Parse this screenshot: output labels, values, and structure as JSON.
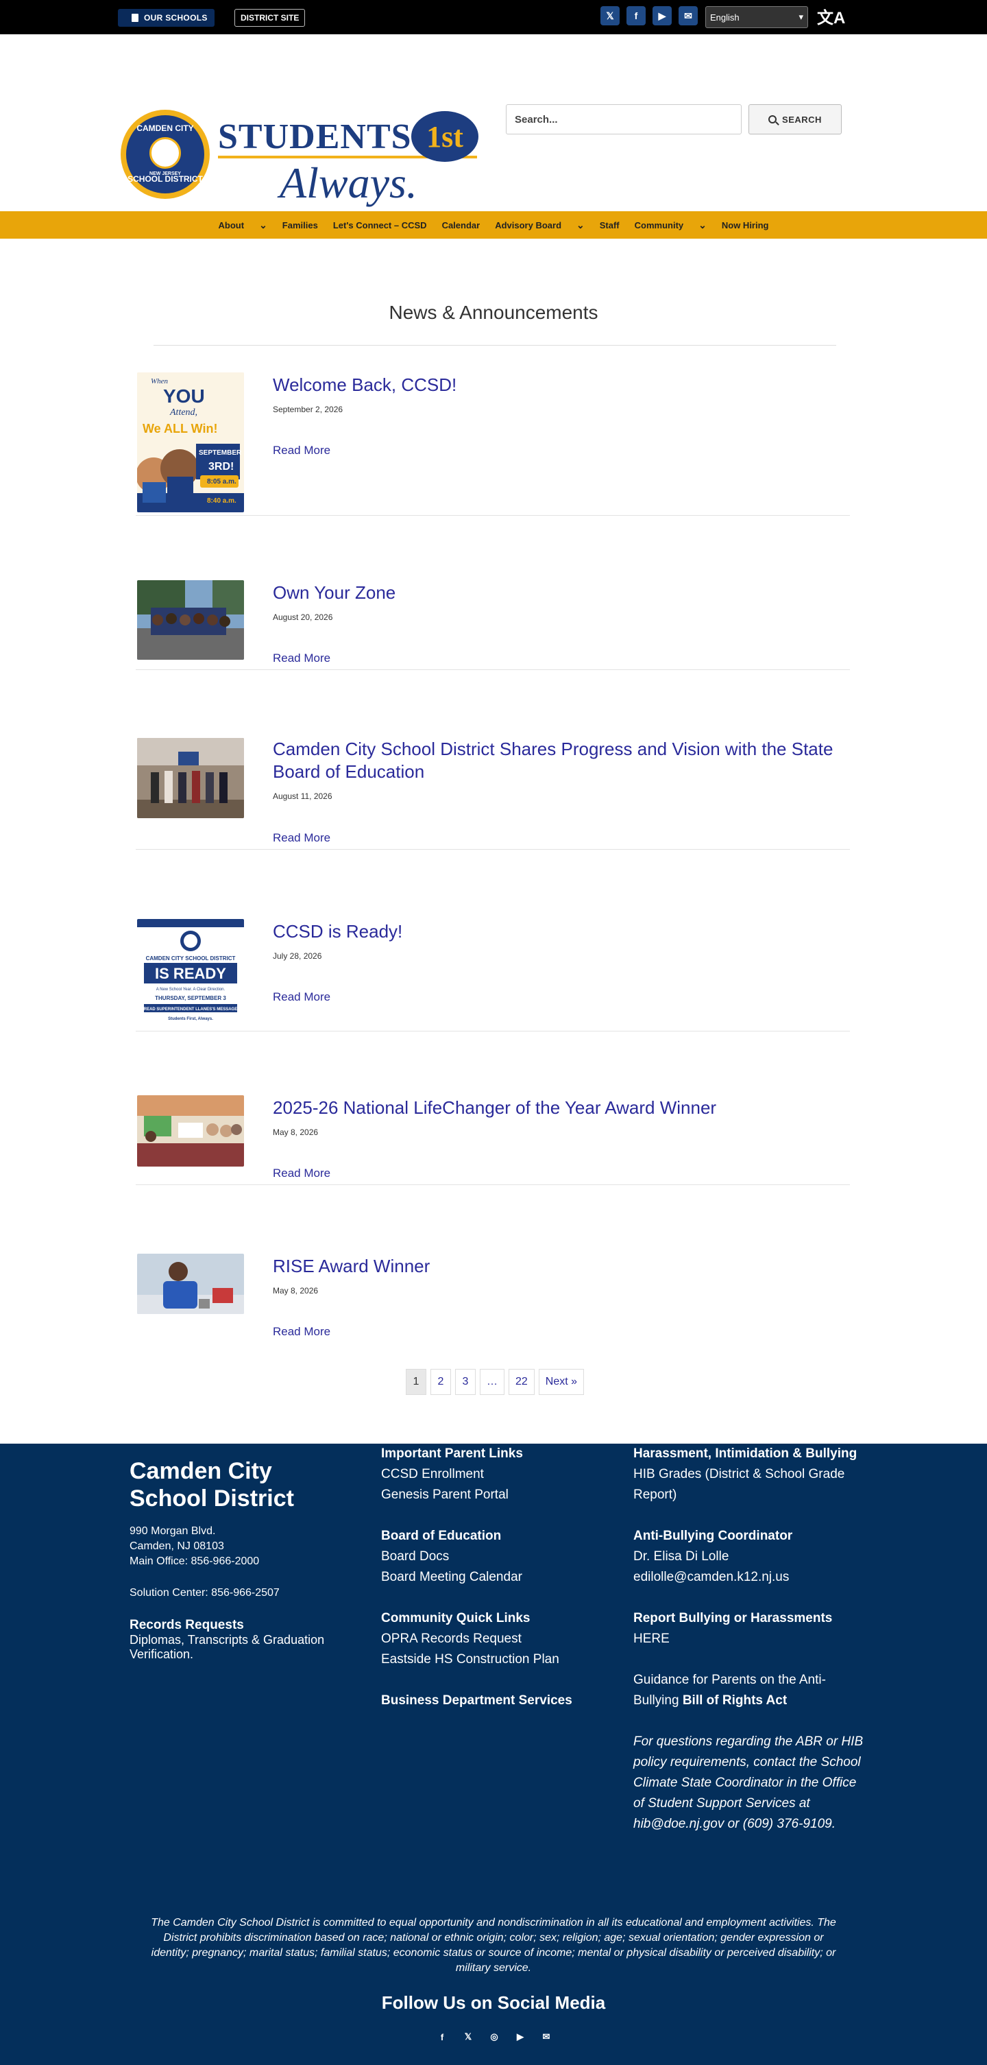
{
  "topbar": {
    "our_schools": "OUR SCHOOLS",
    "district_site": "DISTRICT SITE",
    "social_icons": [
      "x-icon",
      "facebook-icon",
      "youtube-icon",
      "mail-icon"
    ],
    "language": "English"
  },
  "header": {
    "seal_top": "CAMDEN CITY",
    "seal_state": "NEW JERSEY",
    "seal_bottom": "SCHOOL DISTRICT",
    "logo_word1": "STUDENTS",
    "logo_badge": "1st",
    "logo_word2": "Always.",
    "search_placeholder": "Search...",
    "search_button": "SEARCH"
  },
  "nav": {
    "items": [
      "About",
      "Families",
      "Let's Connect – CCSD",
      "Calendar",
      "Advisory Board",
      "Staff",
      "Community",
      "Now Hiring"
    ]
  },
  "main": {
    "title": "News & Announcements",
    "read_more": "Read More",
    "articles": [
      {
        "title": "Welcome Back, CCSD!",
        "date": "September 2, 2026"
      },
      {
        "title": "Own Your Zone",
        "date": "August 20, 2026"
      },
      {
        "title": "Camden City School District Shares Progress and Vision with the State Board of Education",
        "date": "August 11, 2026"
      },
      {
        "title": "CCSD is Ready!",
        "date": "July 28, 2026"
      },
      {
        "title": "2025-26 National LifeChanger of the Year Award Winner",
        "date": "May 8, 2026"
      },
      {
        "title": "RISE Award Winner",
        "date": "May 8, 2026"
      }
    ],
    "poster1": {
      "l1": "When",
      "l2": "YOU",
      "l3": "Attend,",
      "l4": "We ALL Win!",
      "l5": "SEPTEMBER",
      "l6": "3RD!",
      "l7": "8:05 a.m.",
      "l8": "8:40 a.m."
    },
    "poster2": {
      "l1": "CAMDEN CITY SCHOOL DISTRICT",
      "l2": "IS READY",
      "l3": "A New School Year. A Clear Direction.",
      "l4": "THURSDAY, SEPTEMBER 3",
      "l5": "READ SUPERINTENDENT LLANES'S MESSAGE",
      "l6": "Students First, Always."
    },
    "pagination": [
      "1",
      "2",
      "3",
      "…",
      "22",
      "Next »"
    ]
  },
  "footer": {
    "org_name": "Camden City School District",
    "address1": "990 Morgan Blvd.",
    "address2": "Camden, NJ 08103",
    "main_office": "Main Office: 856-966-2000",
    "solution_center": "Solution Center: 856-966-2507",
    "records_heading": "Records Requests",
    "records_text": "Diplomas, Transcripts & Graduation Verification.",
    "col2": {
      "important_heading": "Important Parent Links",
      "important_links": [
        "CCSD Enrollment",
        "Genesis Parent Portal"
      ],
      "board_heading": "Board of Education",
      "board_links": [
        "Board Docs",
        "Board Meeting Calendar"
      ],
      "community_heading": "Community Quick Links",
      "community_links": [
        "OPRA Records Request",
        "Eastside HS Construction Plan"
      ],
      "business_heading": "Business Department Services"
    },
    "col3": {
      "hib_heading": "Harassment, Intimidation & Bullying",
      "hib_link": "HIB Grades (District & School Grade Report)",
      "coordinator_heading": "Anti-Bullying Coordinator",
      "coordinator_name": "Dr. Elisa Di Lolle",
      "coordinator_email": "edilolle@camden.k12.nj.us",
      "report_heading": "Report Bullying or Harassments",
      "report_link": "HERE",
      "guidance_text": "Guidance for Parents on the Anti-Bullying",
      "guidance_bold": "Bill of Rights Act",
      "questions_text": "For questions regarding the ABR or HIB policy requirements, contact the School Climate State Coordinator in the Office of Student Support Services at hib@doe.nj.gov or (609) 376-9109."
    },
    "nondiscrimination": "The Camden City School District is committed to equal opportunity and nondiscrimination in all its educational and employment activities. The District prohibits discrimination based on race; national or ethnic origin; color; sex; religion; age; sexual orientation; gender expression or identity; pregnancy; marital status; familial status; economic status or source of income; mental or physical disability or perceived disability; or military service.",
    "follow_heading": "Follow Us on Social Media",
    "social_icons": [
      "facebook-icon",
      "x-icon",
      "instagram-icon",
      "youtube-icon",
      "mail-icon"
    ]
  }
}
